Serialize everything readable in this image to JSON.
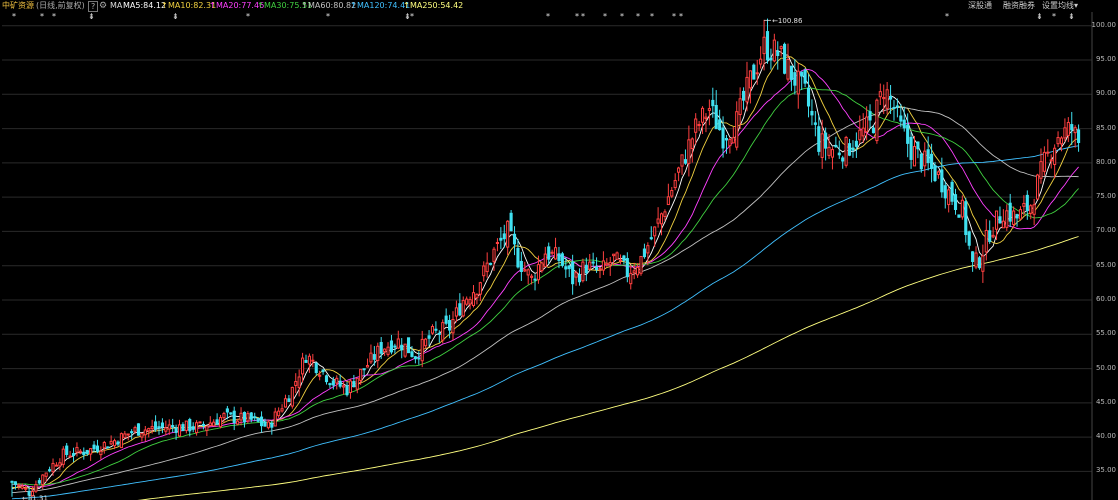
{
  "header": {
    "stock_name": "中矿资源",
    "period": "(日线,前复权)",
    "help": "?",
    "ma_label": "MA",
    "items": [
      {
        "label": "MA5:84.12",
        "color": "#ffffff"
      },
      {
        "label": "MA10:82.31",
        "color": "#f0d040"
      },
      {
        "label": "MA20:77.46",
        "color": "#ff40ff"
      },
      {
        "label": "MA30:75.51",
        "color": "#40d040"
      },
      {
        "label": "MA60:80.82",
        "color": "#c0c0c0"
      },
      {
        "label": "MA120:74.41",
        "color": "#40c0ff"
      },
      {
        "label": "MA250:54.42",
        "color": "#ffff80"
      }
    ],
    "right_links": [
      "深股通",
      "融资融券",
      "设置均线"
    ],
    "right_arrow": "▾"
  },
  "colors": {
    "up": "#ff4040",
    "down": "#40e0f0",
    "bg": "#000000"
  },
  "chart_data": {
    "type": "candlestick",
    "y_ticks": [
      "100.00",
      "95.00",
      "90.00",
      "85.00",
      "80.00",
      "75.00",
      "70.00",
      "65.00",
      "60.00",
      "55.00",
      "50.00",
      "45.00",
      "40.00",
      "35.00"
    ],
    "ylim": [
      32,
      102
    ],
    "annotations": {
      "high": "100.86",
      "low": "31.31"
    },
    "ma_series": [
      {
        "name": "MA5",
        "color": "#ffffff"
      },
      {
        "name": "MA10",
        "color": "#f0d040"
      },
      {
        "name": "MA20",
        "color": "#ff40ff"
      },
      {
        "name": "MA30",
        "color": "#40d040"
      },
      {
        "name": "MA60",
        "color": "#c0c0c0"
      },
      {
        "name": "MA120",
        "color": "#40c0ff"
      },
      {
        "name": "MA250",
        "color": "#ffff80"
      }
    ],
    "waypoints": [
      [
        0,
        33.5
      ],
      [
        5,
        32
      ],
      [
        10,
        35
      ],
      [
        15,
        37.5
      ],
      [
        22,
        38
      ],
      [
        30,
        39.5
      ],
      [
        36,
        41
      ],
      [
        46,
        41.5
      ],
      [
        55,
        41.5
      ],
      [
        62,
        43
      ],
      [
        70,
        42.5
      ],
      [
        75,
        41.5
      ],
      [
        82,
        47
      ],
      [
        86,
        52
      ],
      [
        90,
        50
      ],
      [
        94,
        48
      ],
      [
        98,
        47
      ],
      [
        103,
        50
      ],
      [
        108,
        53
      ],
      [
        113,
        54
      ],
      [
        118,
        52
      ],
      [
        123,
        55
      ],
      [
        128,
        56
      ],
      [
        132,
        60
      ],
      [
        136,
        62
      ],
      [
        141,
        67
      ],
      [
        145,
        70
      ],
      [
        148,
        66
      ],
      [
        152,
        63
      ],
      [
        156,
        67
      ],
      [
        160,
        66
      ],
      [
        164,
        63
      ],
      [
        168,
        65
      ],
      [
        172,
        64
      ],
      [
        176,
        66
      ],
      [
        180,
        64
      ],
      [
        184,
        66
      ],
      [
        188,
        70
      ],
      [
        192,
        75
      ],
      [
        196,
        80
      ],
      [
        200,
        85
      ],
      [
        204,
        88
      ],
      [
        208,
        84
      ],
      [
        212,
        86
      ],
      [
        216,
        92
      ],
      [
        220,
        97
      ],
      [
        224,
        96
      ],
      [
        228,
        93
      ],
      [
        232,
        90
      ],
      [
        236,
        83
      ],
      [
        240,
        82
      ],
      [
        244,
        82
      ],
      [
        248,
        84
      ],
      [
        252,
        86
      ],
      [
        255,
        91
      ],
      [
        258,
        88
      ],
      [
        260,
        85
      ],
      [
        263,
        82
      ],
      [
        267,
        80
      ],
      [
        271,
        78
      ],
      [
        275,
        75
      ],
      [
        278,
        73
      ],
      [
        281,
        65
      ],
      [
        283,
        66
      ],
      [
        286,
        70
      ],
      [
        290,
        73
      ],
      [
        294,
        72
      ],
      [
        298,
        74
      ],
      [
        302,
        80
      ],
      [
        306,
        84
      ],
      [
        310,
        85
      ],
      [
        312,
        83
      ]
    ]
  }
}
